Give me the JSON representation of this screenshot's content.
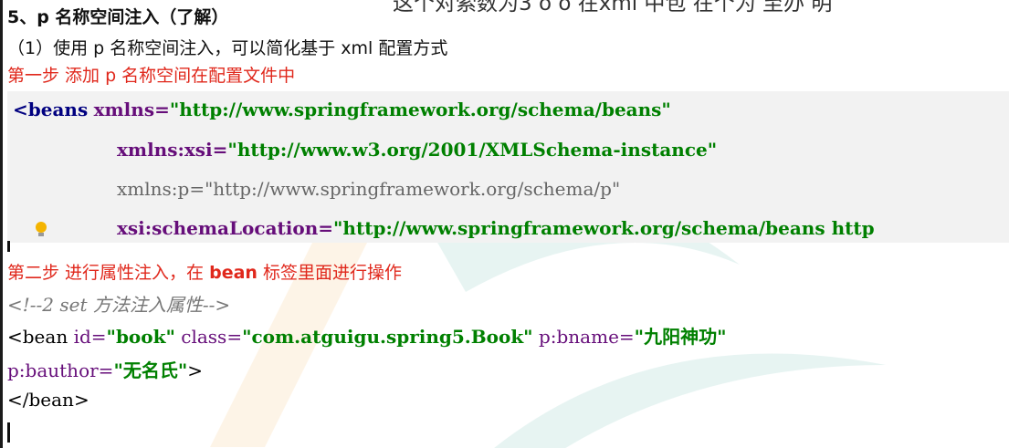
{
  "overlay_text": "这个对索数为3 o o 在xml 中包 在个为 至办 明",
  "heading": "5、p 名称空间注入（了解）",
  "intro": "（1）使用 p 名称空间注入，可以简化基于 xml 配置方式",
  "step1": "第一步 添加 p 名称空间在配置文件中",
  "beans_open": "<beans",
  "xmlns_attr": "xmlns=",
  "xmlns_val": "\"http://www.springframework.org/schema/beans\"",
  "xsi_attr": "xmlns:xsi=",
  "xsi_val": "\"http://www.w3.org/2001/XMLSchema-instance\"",
  "p_line": "xmlns:p=\"http://www.springframework.org/schema/p\"",
  "schema_attr": "xsi:schemaLocation=",
  "schema_val": "\"http://www.springframework.org/schema/beans http",
  "step2_a": "第二步 进行属性注入，在 ",
  "step2_bean": "bean",
  "step2_b": " 标签里面进行操作",
  "comment": "<!--2 set 方法注入属性-->",
  "bean_tag": "<bean",
  "id_attr": "id=",
  "id_val": "\"book\"",
  "class_attr": "class=",
  "class_val": "\"com.atguigu.spring5.Book\"",
  "pbname_attr": "p:bname=",
  "pbname_val": "\"九阳神功\"",
  "pbauthor_attr": "p:bauthor=",
  "pbauthor_val": "\"无名氏\"",
  "gt": ">",
  "bean_close": "</bean>"
}
